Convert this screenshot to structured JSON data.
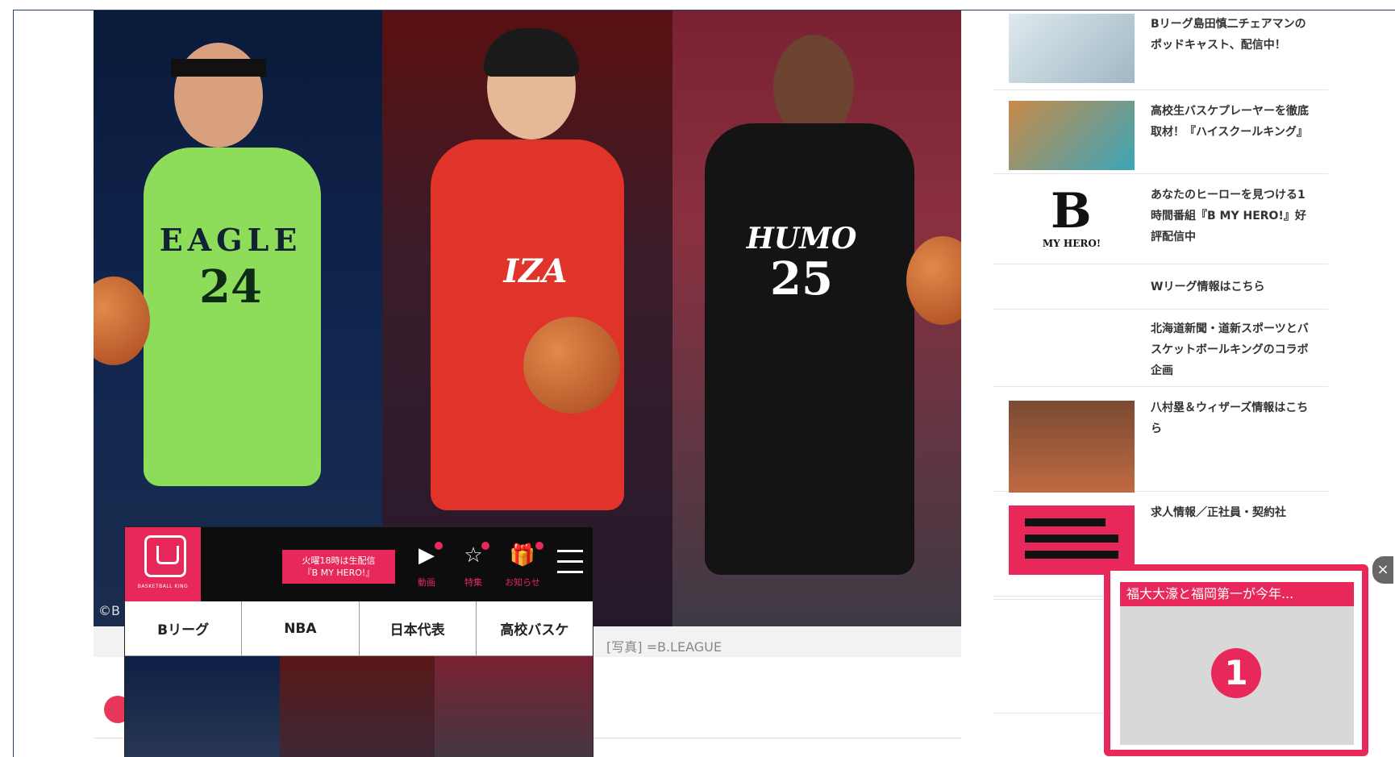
{
  "hero": {
    "credit": "©B",
    "caption": "[写真] =B.LEAGUE",
    "panels": [
      {
        "name": "green-jersey-player",
        "jersey_text": "EAGLE",
        "number": "24"
      },
      {
        "name": "red-jersey-player",
        "jersey_text": "IZA",
        "number": ""
      },
      {
        "name": "black-jersey-player",
        "jersey_text": "HUMO",
        "number": "25"
      }
    ]
  },
  "phone": {
    "logo_text": "BASKETBALL KING",
    "promo": "火曜18時は生配信\n『B MY HERO!』",
    "icons": [
      {
        "label": "動画",
        "glyph": "▶"
      },
      {
        "label": "特集",
        "glyph": "☆"
      },
      {
        "label": "お知らせ",
        "glyph": "🎁"
      }
    ],
    "tabs": [
      "Bリーグ",
      "NBA",
      "日本代表",
      "高校バスケ"
    ]
  },
  "sidebar": {
    "items": [
      {
        "text": "Bリーグ島田慎二チェアマンのポッドキャスト、配信中！",
        "thumb": "podcast"
      },
      {
        "text": "高校生バスケプレーヤーを徹底取材！『ハイスクールキング』",
        "thumb": "highschool"
      },
      {
        "text": "あなたのヒーローを見つける1時間番組『B MY HERO!』好評配信中",
        "thumb": "bmyhero",
        "logo_letter": "B",
        "logo_sub": "MY HERO!"
      },
      {
        "text": "Wリーグ情報はこちら",
        "thumb": "none"
      },
      {
        "text": "北海道新聞・道新スポーツとバスケットボールキングのコラボ企画",
        "thumb": "none"
      },
      {
        "text": "八村塁＆ウィザーズ情報はこちら",
        "thumb": "wizards"
      },
      {
        "text": "求人情報／正社員・契約社",
        "thumb": "jobs"
      }
    ]
  },
  "popup": {
    "title": "福大大濠と福岡第一が今年...",
    "number": "1",
    "close": "×"
  },
  "colors": {
    "accent": "#e8285a",
    "frame": "#2b3f6c"
  }
}
